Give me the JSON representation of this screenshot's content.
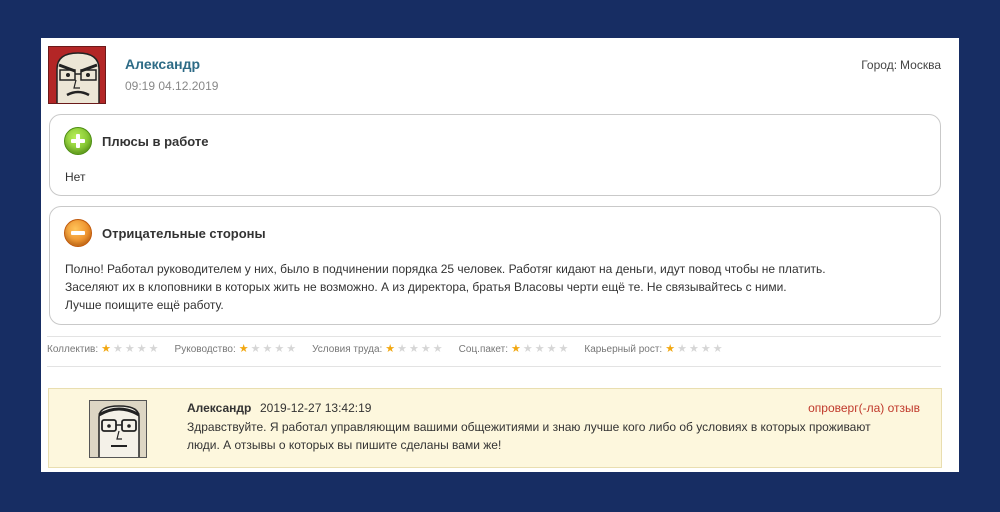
{
  "review": {
    "author": "Александр",
    "date": "09:19 04.12.2019",
    "city_label": "Город:",
    "city": "Москва",
    "pros": {
      "title": "Плюсы в работе",
      "text": "Нет",
      "icon": "plus-circle-icon"
    },
    "cons": {
      "title": "Отрицательные стороны",
      "icon": "minus-circle-icon",
      "lines": [
        "Полно! Работал руководителем у них, было в подчинении порядка 25 человек. Работяг кидают на деньги, идут повод чтобы не платить.",
        "Заселяют их в клоповники в которых жить не возможно. А из директора, братья Власовы черти ещё те. Не связывайтесь с ними.",
        "Лучше поищите ещё работу."
      ]
    },
    "ratings": [
      {
        "label": "Коллектив:",
        "value": 1,
        "max": 5
      },
      {
        "label": "Руководство:",
        "value": 1,
        "max": 5
      },
      {
        "label": "Условия труда:",
        "value": 1,
        "max": 5
      },
      {
        "label": "Соц.пакет:",
        "value": 1,
        "max": 5
      },
      {
        "label": "Карьерный рост:",
        "value": 1,
        "max": 5
      }
    ]
  },
  "reply": {
    "author": "Александр",
    "timestamp": "2019-12-27 13:42:19",
    "status": "опроверг(-ла) отзыв",
    "lines": [
      "Здравствуйте. Я работал управляющим вашими общежитиями и знаю лучше кого либо об условиях в которых проживают",
      "люди. А отзывы о которых вы пишите сделаны вами же!"
    ]
  },
  "colors": {
    "page_background": "#172d63",
    "author_link": "#2d6b86",
    "star_active": "#f2a812",
    "star_inactive": "#d6d6d6",
    "reply_background": "#fdf7dd",
    "status_red": "#c0392b"
  }
}
